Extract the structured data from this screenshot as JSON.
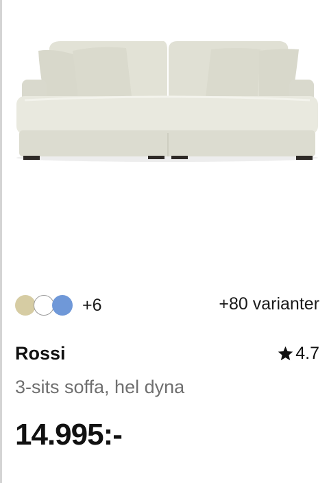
{
  "product": {
    "image_alt": "Rossi 3-sits soffa",
    "colors": [
      {
        "name": "beige",
        "hex": "#d6cca3"
      },
      {
        "name": "white",
        "hex": "#ffffff"
      },
      {
        "name": "blue",
        "hex": "#6f98d8"
      }
    ],
    "more_colors": "+6",
    "variants": "+80 varianter",
    "name": "Rossi",
    "rating_icon": "star-icon",
    "rating": "4.7",
    "description": "3-sits soffa, hel dyna",
    "price": "14.995:-"
  }
}
